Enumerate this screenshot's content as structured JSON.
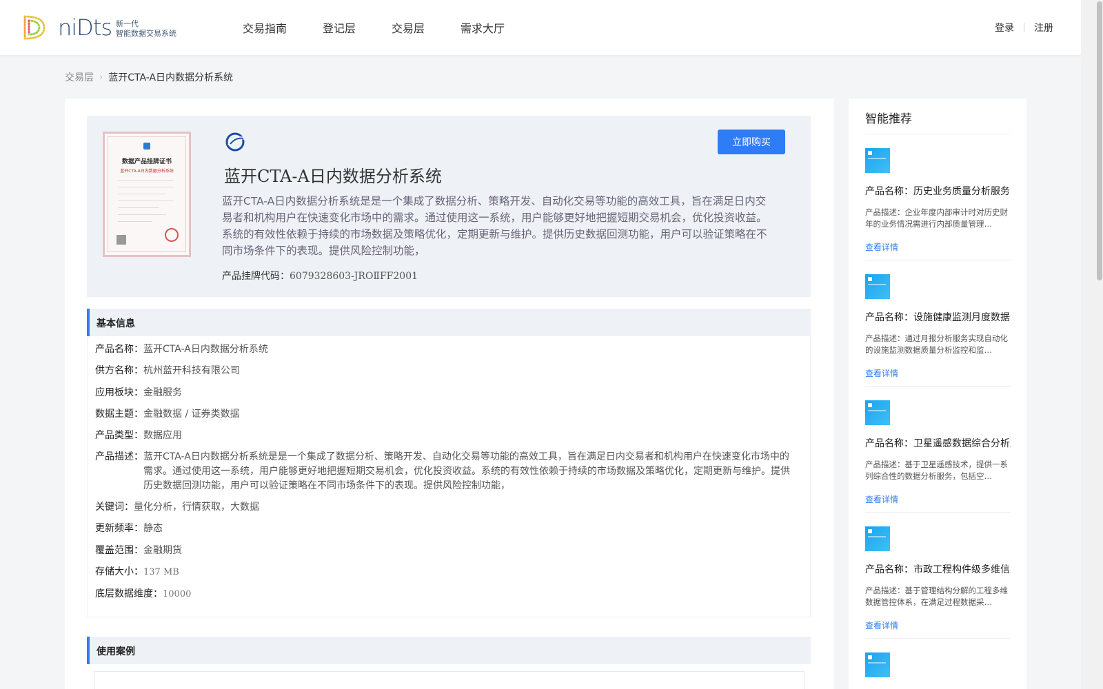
{
  "header": {
    "logo_word": "niDts",
    "logo_sub1": "新一代",
    "logo_sub2": "智能数据交易系统",
    "nav": [
      "交易指南",
      "登记层",
      "交易层",
      "需求大厅"
    ],
    "login": "登录",
    "register": "注册"
  },
  "breadcrumb": {
    "parent": "交易层",
    "current": "蓝开CTA-A日内数据分析系统"
  },
  "product": {
    "title": "蓝开CTA-A日内数据分析系统",
    "description": "蓝开CTA-A日内数据分析系统是是一个集成了数据分析、策略开发、自动化交易等功能的高效工具，旨在满足日内交易者和机构用户在快速变化市场中的需求。通过使用这一系统，用户能够更好地把握短期交易机会，优化投资收益。系统的有效性依赖于持续的市场数据及策略优化，定期更新与维护。提供历史数据回测功能，用户可以验证策略在不同市场条件下的表现。提供风险控制功能，",
    "code_label": "产品挂牌代码：",
    "code_value": "6079328603-JROⅡFF2001",
    "buy_label": "立即购买",
    "cert_title": "数据产品挂牌证书",
    "cert_sub": "蓝开CTA-A日内数据分析系统"
  },
  "basic_info": {
    "heading": "基本信息",
    "rows": [
      {
        "label": "产品名称：",
        "value": "蓝开CTA-A日内数据分析系统"
      },
      {
        "label": "供方名称：",
        "value": "杭州蓝开科技有限公司"
      },
      {
        "label": "应用板块：",
        "value": "金融服务"
      },
      {
        "label": "数据主题：",
        "value": "金融数据 / 证券类数据"
      },
      {
        "label": "产品类型：",
        "value": "数据应用"
      },
      {
        "label": "产品描述：",
        "value": "蓝开CTA-A日内数据分析系统是是一个集成了数据分析、策略开发、自动化交易等功能的高效工具，旨在满足日内交易者和机构用户在快速变化市场中的需求。通过使用这一系统，用户能够更好地把握短期交易机会，优化投资收益。系统的有效性依赖于持续的市场数据及策略优化，定期更新与维护。提供历史数据回测功能，用户可以验证策略在不同市场条件下的表现。提供风险控制功能，"
      },
      {
        "label": "关键词：",
        "value": "量化分析，行情获取，大数据"
      },
      {
        "label": "更新频率：",
        "value": "静态"
      },
      {
        "label": "覆盖范围：",
        "value": "金融期货"
      },
      {
        "label": "存储大小：",
        "value": "137 MB"
      },
      {
        "label": "底层数据维度：",
        "value": "10000"
      }
    ]
  },
  "use_cases": {
    "heading": "使用案例"
  },
  "recommend": {
    "title": "智能推荐",
    "items": [
      {
        "name": "产品名称：历史业务质量分析服务",
        "desc": "产品描述：企业年度内部审计时对历史财年的业务情况需进行内部质量管理…",
        "link": "查看详情"
      },
      {
        "name": "产品名称：设施健康监测月度数据分析",
        "desc": "产品描述：通过月报分析服务实现自动化的设施监测数据质量分析监控和监…",
        "link": "查看详情"
      },
      {
        "name": "产品名称：卫星遥感数据综合分析服务",
        "desc": "产品描述：基于卫星遥感技术，提供一系列综合性的数据分析服务，包括空…",
        "link": "查看详情"
      },
      {
        "name": "产品名称：市政工程构件级多维信息管理",
        "desc": "产品描述：基于管理结构分解的工程多维数据管控体系，在满足过程数据采…",
        "link": "查看详情"
      }
    ]
  },
  "colors": {
    "accent": "#2e7cf6",
    "hero_bg": "#eef1f5"
  }
}
